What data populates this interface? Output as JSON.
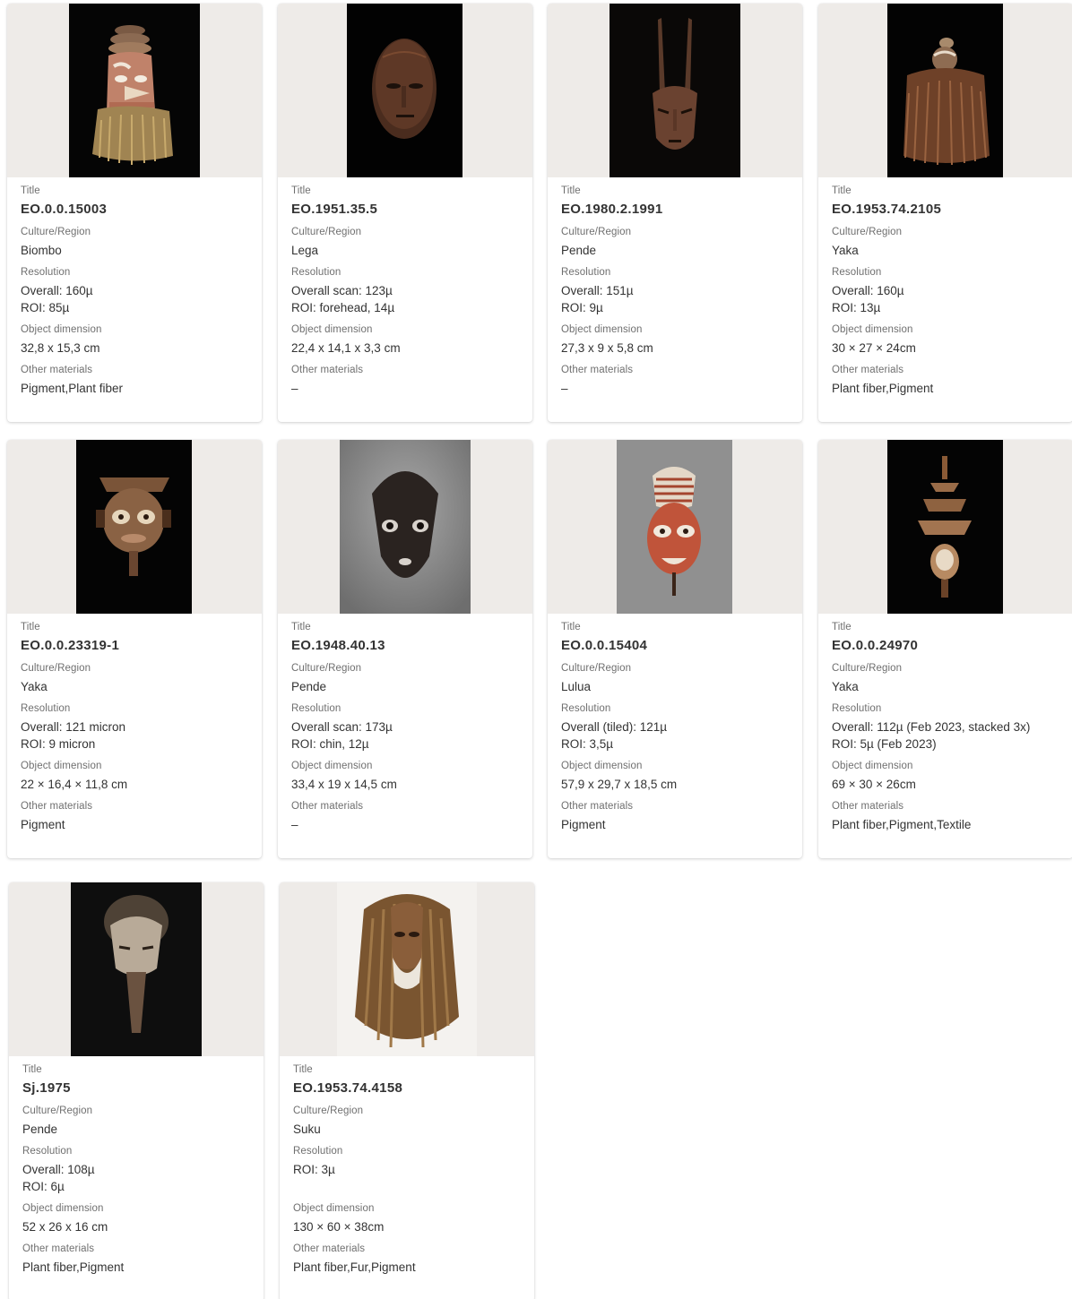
{
  "labels": {
    "title": "Title",
    "culture": "Culture/Region",
    "resolution": "Resolution",
    "dimension": "Object dimension",
    "materials": "Other materials"
  },
  "cards": [
    {
      "title": "EO.0.0.15003",
      "culture": "Biombo",
      "resolution": [
        "Overall: 160µ",
        "ROI: 85µ"
      ],
      "dimension": "32,8 x 15,3 cm",
      "materials": "Pigment,Plant fiber",
      "image": "mask-biombo-photo"
    },
    {
      "title": "EO.1951.35.5",
      "culture": "Lega",
      "resolution": [
        "Overall scan: 123µ",
        "ROI: forehead, 14µ"
      ],
      "dimension": "22,4 x 14,1 x 3,3 cm",
      "materials": "–",
      "image": "mask-lega-photo"
    },
    {
      "title": "EO.1980.2.1991",
      "culture": "Pende",
      "resolution": [
        "Overall: 151µ",
        "ROI: 9µ"
      ],
      "dimension": "27,3 x 9 x 5,8 cm",
      "materials": "–",
      "image": "mask-pende-horned-photo"
    },
    {
      "title": "EO.1953.74.2105",
      "culture": "Yaka",
      "resolution": [
        "Overall: 160µ",
        "ROI: 13µ"
      ],
      "dimension": "30 × 27 × 24cm",
      "materials": "Plant fiber,Pigment",
      "image": "mask-yaka-fiber-photo"
    },
    {
      "title": "EO.0.0.23319-1",
      "culture": "Yaka",
      "resolution": [
        "Overall: 121 micron",
        "ROI: 9 micron"
      ],
      "dimension": "22 × 16,4 × 11,8 cm",
      "materials": "Pigment",
      "image": "mask-yaka-handle-photo"
    },
    {
      "title": "EO.1948.40.13",
      "culture": "Pende",
      "resolution": [
        "Overall scan: 173µ",
        "ROI: chin, 12µ"
      ],
      "dimension": "33,4 x 19 x 14,5 cm",
      "materials": "–",
      "image": "mask-pende-dark-photo"
    },
    {
      "title": "EO.0.0.15404",
      "culture": "Lulua",
      "resolution": [
        "Overall (tiled): 121µ",
        "ROI: 3,5µ"
      ],
      "dimension": "57,9 x 29,7 x 18,5 cm",
      "materials": "Pigment",
      "image": "mask-lulua-photo"
    },
    {
      "title": "EO.0.0.24970",
      "culture": "Yaka",
      "resolution": [
        "Overall: 112µ (Feb 2023, stacked 3x)",
        "ROI: 5µ (Feb 2023)"
      ],
      "dimension": "69 × 30 × 26cm",
      "materials": "Plant fiber,Pigment,Textile",
      "image": "mask-yaka-tall-photo"
    },
    {
      "title": "Sj.1975",
      "culture": "Pende",
      "resolution": [
        "Overall: 108µ",
        "ROI: 6µ"
      ],
      "dimension": "52 x 26 x 16 cm",
      "materials": "Plant fiber,Pigment",
      "image": "mask-pende-long-photo"
    },
    {
      "title": "EO.1953.74.4158",
      "culture": "Suku",
      "resolution": [
        "ROI: 3µ"
      ],
      "dimension": "130 × 60 × 38cm",
      "materials": "Plant fiber,Fur,Pigment",
      "image": "mask-suku-photo"
    }
  ]
}
